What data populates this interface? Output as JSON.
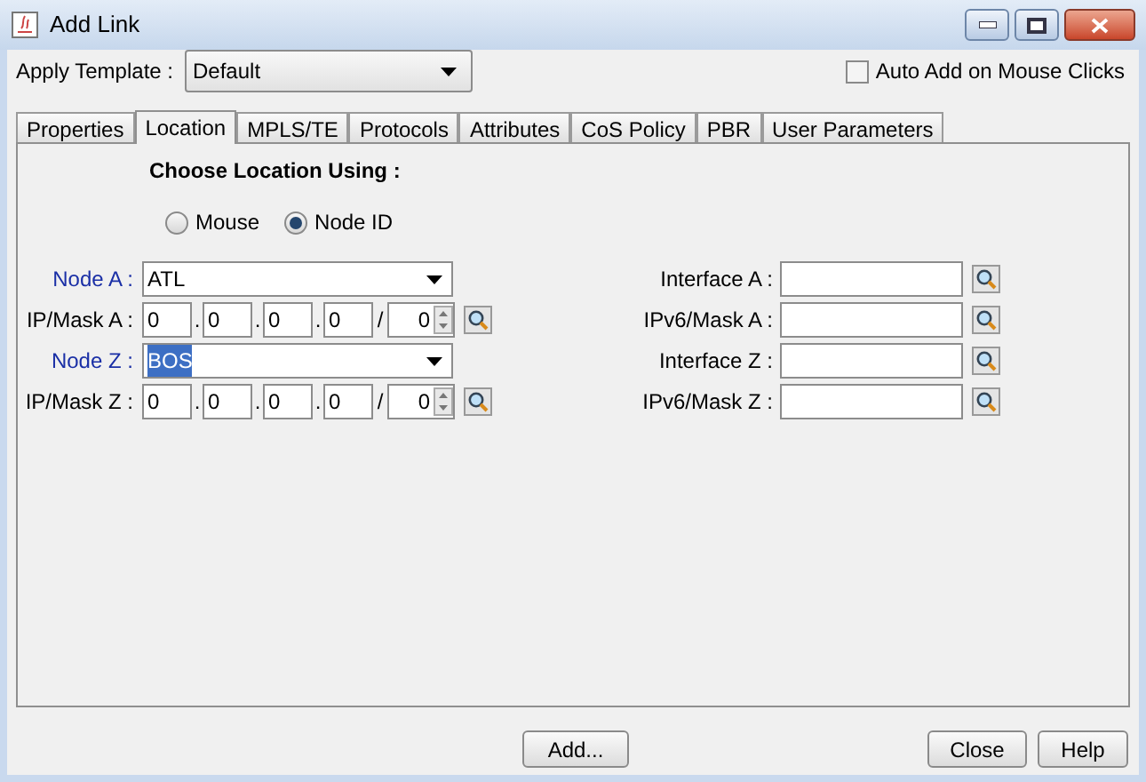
{
  "window": {
    "title": "Add Link"
  },
  "template": {
    "label": "Apply Template :",
    "value": "Default"
  },
  "auto_add": {
    "label": "Auto Add on Mouse Clicks",
    "checked": false
  },
  "tabs": [
    {
      "label": "Properties",
      "selected": false
    },
    {
      "label": "Location",
      "selected": true
    },
    {
      "label": "MPLS/TE",
      "selected": false
    },
    {
      "label": "Protocols",
      "selected": false
    },
    {
      "label": "Attributes",
      "selected": false
    },
    {
      "label": "CoS Policy",
      "selected": false
    },
    {
      "label": "PBR",
      "selected": false
    },
    {
      "label": "User Parameters",
      "selected": false
    }
  ],
  "location": {
    "heading": "Choose Location Using :",
    "options": [
      {
        "label": "Mouse",
        "selected": false
      },
      {
        "label": "Node ID",
        "selected": true
      }
    ],
    "left_rows": [
      {
        "kind": "combo",
        "label": "Node A :",
        "value": "ATL",
        "text_selected": false
      },
      {
        "kind": "ip",
        "label": "IP/Mask A :",
        "octets": [
          "0",
          "0",
          "0",
          "0"
        ],
        "separators": [
          ".",
          ".",
          "."
        ],
        "mask_separator": "/",
        "mask": "0"
      },
      {
        "kind": "combo",
        "label": "Node Z :",
        "value": "BOS",
        "text_selected": true
      },
      {
        "kind": "ip",
        "label": "IP/Mask Z :",
        "octets": [
          "0",
          "0",
          "0",
          "0"
        ],
        "separators": [
          ".",
          ".",
          "."
        ],
        "mask_separator": "/",
        "mask": "0"
      }
    ],
    "right_rows": [
      {
        "label": "Interface A :"
      },
      {
        "label": "IPv6/Mask A :"
      },
      {
        "label": "Interface Z :"
      },
      {
        "label": "IPv6/Mask Z :"
      }
    ]
  },
  "buttons": {
    "add": "Add...",
    "close": "Close",
    "help": "Help"
  }
}
